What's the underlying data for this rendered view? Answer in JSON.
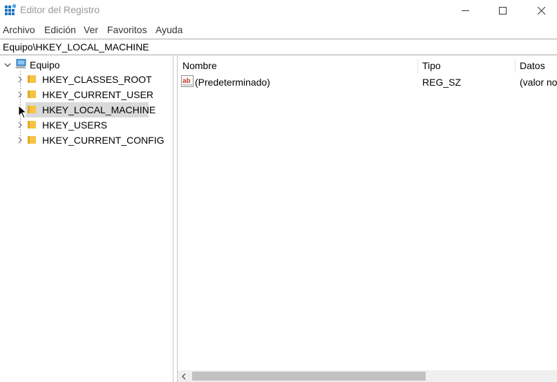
{
  "window": {
    "title": "Editor del Registro",
    "icon": "registry-editor-icon",
    "controls": {
      "minimize": "minimize-icon",
      "maximize": "maximize-icon",
      "close": "close-icon"
    }
  },
  "menu": {
    "items": [
      "Archivo",
      "Edición",
      "Ver",
      "Favoritos",
      "Ayuda"
    ]
  },
  "address": {
    "path": "Equipo\\HKEY_LOCAL_MACHINE"
  },
  "tree": {
    "root": "Equipo",
    "children": [
      {
        "label": "HKEY_CLASSES_ROOT",
        "selected": false
      },
      {
        "label": "HKEY_CURRENT_USER",
        "selected": false
      },
      {
        "label": "HKEY_LOCAL_MACHINE",
        "selected": true
      },
      {
        "label": "HKEY_USERS",
        "selected": false
      },
      {
        "label": "HKEY_CURRENT_CONFIG",
        "selected": false
      }
    ]
  },
  "list": {
    "columns": [
      "Nombre",
      "Tipo",
      "Datos"
    ],
    "rows": [
      {
        "name": "(Predeterminado)",
        "type": "REG_SZ",
        "data": "(valor no"
      }
    ]
  },
  "colors": {
    "selection": "#d9d9d9",
    "folder": "#f6c344",
    "title_text": "#999999"
  }
}
